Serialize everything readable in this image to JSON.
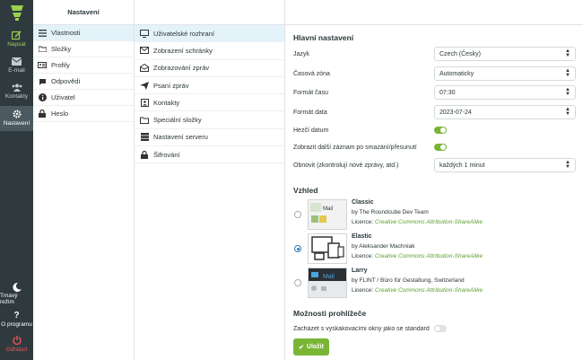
{
  "nav": {
    "compose": "Napsat",
    "mail": "E-mail",
    "contacts": "Kontakty",
    "settings": "Nastavení",
    "darkmode": "Tmavý režim",
    "about": "O programu",
    "logout": "Odhlásit"
  },
  "settings_col": {
    "title": "Nastavení",
    "items": [
      "Vlastnosti",
      "Složky",
      "Profily",
      "Odpovědi",
      "Uživatel",
      "Heslo"
    ]
  },
  "sections": {
    "items": [
      "Uživatelské rozhraní",
      "Zobrazení schránky",
      "Zobrazování zpráv",
      "Psaní zpráv",
      "Kontakty",
      "Speciální složky",
      "Nastavení serveru",
      "Šifrování"
    ]
  },
  "main": {
    "heading": "Hlavní nastavení",
    "rows": [
      {
        "label": "Jazyk",
        "value": "Czech (Česky)"
      },
      {
        "label": "Časová zóna",
        "value": "Automaticky"
      },
      {
        "label": "Formát času",
        "value": "07:30"
      },
      {
        "label": "Formát data",
        "value": "2023-07-24"
      },
      {
        "label": "Hezčí datum"
      },
      {
        "label": "Zobrazit další záznam po smazání/přesunutí"
      },
      {
        "label": "Obnovit (zkontrolují nové zprávy, atd.)",
        "value": "každých 1 minut"
      }
    ],
    "appearance_heading": "Vzhled",
    "skins": [
      {
        "name": "Classic",
        "author": "by The Roundcube Dev Team",
        "licence_label": "Licence:",
        "licence": "Creative Commons Attribution-ShareAlike"
      },
      {
        "name": "Elastic",
        "author": "by Aleksander Machniak",
        "licence_label": "Licence:",
        "licence": "Creative Commons Attribution-ShareAlike"
      },
      {
        "name": "Larry",
        "author": "by FLINT / Büro für Gestaltung, Switzerland",
        "licence_label": "Licence:",
        "licence": "Creative Commons Attribution-ShareAlike"
      }
    ],
    "browser_heading": "Možnosti prohlížeče",
    "browser_row": "Zacházet s vyskakovacími okny jako se standard",
    "save": "Uložit"
  },
  "colors": {
    "accent": "#7ab536",
    "nav_bg": "#2f3a3f",
    "selected": "#e4f2f9"
  }
}
